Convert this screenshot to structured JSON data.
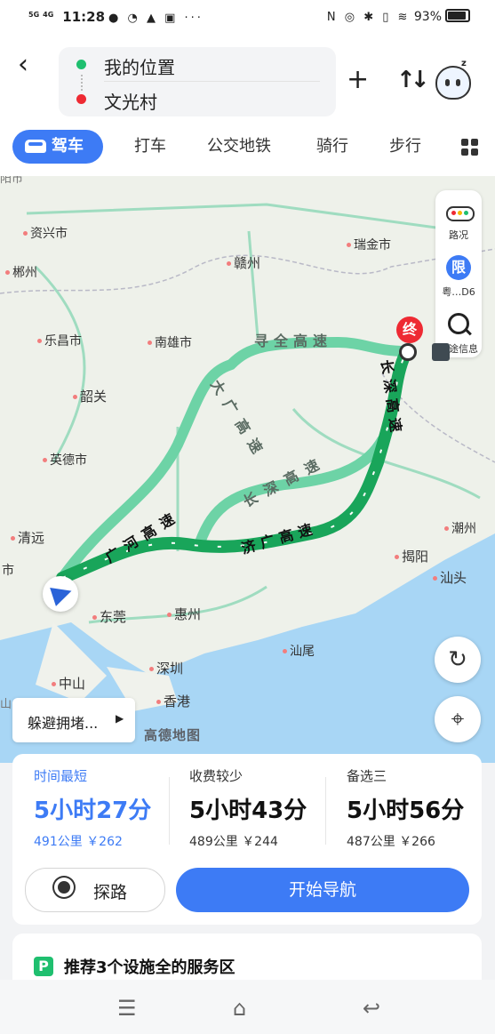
{
  "status_bar": {
    "network_1": "5G",
    "network_2": "4G",
    "time": "11:28",
    "left_icons": "● ◔ ▲ ▣ ···",
    "right_icons": "N ◎ ✱ ▯ ≋",
    "battery": "93%"
  },
  "route": {
    "origin": "我的位置",
    "destination": "文光村"
  },
  "tabs": [
    "驾车",
    "打车",
    "公交地铁",
    "骑行",
    "步行"
  ],
  "map": {
    "cities": {
      "zixing": "资兴市",
      "chenzhou": "郴州",
      "ganzhou": "赣州",
      "ruijin": "瑞金市",
      "lechang": "乐昌市",
      "nanxiong": "南雄市",
      "shaoguan": "韶关",
      "yingde": "英德市",
      "qingyuan": "清远",
      "shi": "市",
      "dongguan": "东莞",
      "huizhou": "惠州",
      "shenzhen": "深圳",
      "zhongshan": "中山",
      "xianggang": "香港",
      "shanwei": "汕尾",
      "jieyang": "揭阳",
      "shantou": "汕头",
      "chaozhou": "潮州",
      "shan": "山",
      "top_partial": "阳市"
    },
    "highways": {
      "xunquan": "寻全高速",
      "daguang": "大广高速",
      "changshen_main": "长深高速",
      "changshen_alt": "长深高速",
      "guanghe": "广河高速",
      "jiguang": "济广高速"
    },
    "tools": {
      "traffic_label": "路况",
      "limit_badge": "限",
      "limit_label": "粤…D6",
      "longdist_label": "长途信息"
    },
    "end_marker": "终",
    "avoid_label": "躲避拥堵...",
    "logo": "高德地图",
    "route_colors": {
      "main": "#19a55a",
      "alt": "#6dd3a6"
    }
  },
  "options": [
    {
      "tag": "时间最短",
      "time": "5小时27分",
      "distance": "491公里",
      "toll": "￥262"
    },
    {
      "tag": "收费较少",
      "time": "5小时43分",
      "distance": "489公里",
      "toll": "￥244"
    },
    {
      "tag": "备选三",
      "time": "5小时56分",
      "distance": "487公里",
      "toll": "￥266"
    }
  ],
  "actions": {
    "probe": "探路",
    "start": "开始导航"
  },
  "service": {
    "icon": "P",
    "text": "推荐3个设施全的服务区"
  }
}
